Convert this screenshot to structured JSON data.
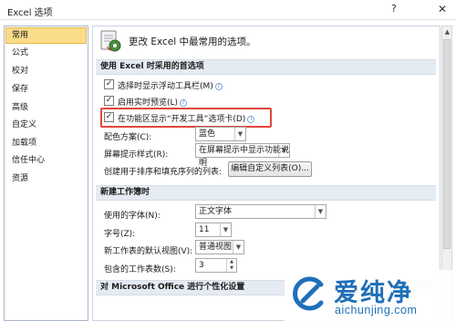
{
  "window": {
    "title": "Excel 选项",
    "help_icon": "?",
    "close_icon": "✕"
  },
  "nav": {
    "items": [
      {
        "label": "常用",
        "selected": true
      },
      {
        "label": "公式"
      },
      {
        "label": "校对"
      },
      {
        "label": "保存"
      },
      {
        "label": "高级"
      },
      {
        "label": "自定义"
      },
      {
        "label": "加载项"
      },
      {
        "label": "信任中心"
      },
      {
        "label": "资源"
      }
    ]
  },
  "header": {
    "text": "更改 Excel 中最常用的选项。",
    "icon": "options-gear-icon"
  },
  "sections": {
    "top_options": "使用 Excel 时采用的首选项",
    "new_workbook": "新建工作簿时",
    "personalize": "对 Microsoft Office 进行个性化设置"
  },
  "options": {
    "mini_toolbar": {
      "label": "选择时显示浮动工具栏(M)",
      "checked": true
    },
    "live_preview": {
      "label": "启用实时预览(L)",
      "checked": true
    },
    "developer_tab": {
      "label": "在功能区显示“开发工具”选项卡(D)",
      "checked": true
    },
    "info_icon": "i"
  },
  "color_scheme": {
    "label": "配色方案(C):",
    "value": "蓝色"
  },
  "screentip": {
    "label": "屏幕提示样式(R):",
    "value": "在屏幕提示中显示功能说明"
  },
  "custom_lists": {
    "label": "创建用于排序和填充序列的列表:",
    "button": "编辑自定义列表(O)..."
  },
  "new_workbook": {
    "font": {
      "label": "使用的字体(N):",
      "value": "正文字体"
    },
    "font_size": {
      "label": "字号(Z):",
      "value": "11"
    },
    "default_view": {
      "label": "新工作表的默认视图(V):",
      "value": "普通视图"
    },
    "sheet_count": {
      "label": "包含的工作表数(S):",
      "value": "3"
    }
  },
  "watermark": {
    "text_cn": "爱纯净",
    "text_en": "aichunjing.com"
  },
  "colors": {
    "selected_nav_bg": "#fbdc8a",
    "section_bg": "#e5ebf2",
    "highlight_border": "#e0463c",
    "watermark_blue": "#1f6fb8"
  }
}
